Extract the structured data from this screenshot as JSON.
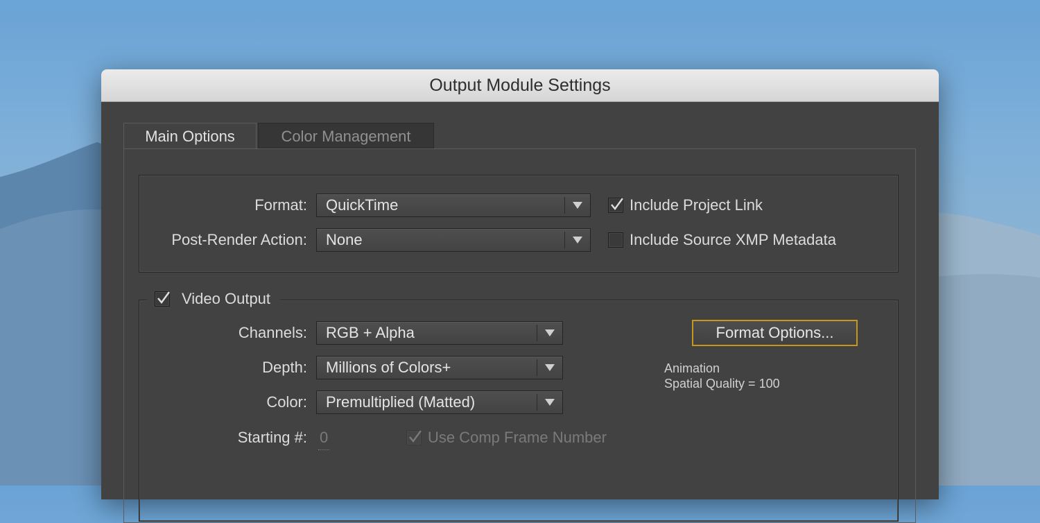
{
  "window": {
    "title": "Output Module Settings"
  },
  "tabs": [
    {
      "label": "Main Options",
      "active": true
    },
    {
      "label": "Color Management",
      "active": false
    }
  ],
  "main": {
    "format_label": "Format:",
    "format_value": "QuickTime",
    "post_render_label": "Post-Render Action:",
    "post_render_value": "None",
    "include_project_link": {
      "label": "Include Project Link",
      "checked": true
    },
    "include_xmp": {
      "label": "Include Source XMP Metadata",
      "checked": false
    }
  },
  "video_output": {
    "label": "Video Output",
    "checked": true,
    "channels_label": "Channels:",
    "channels_value": "RGB + Alpha",
    "depth_label": "Depth:",
    "depth_value": "Millions of Colors+",
    "color_label": "Color:",
    "color_value": "Premultiplied (Matted)",
    "starting_label": "Starting #:",
    "starting_value": "0",
    "use_comp_frame": {
      "label": "Use Comp Frame Number",
      "checked": true,
      "disabled": true
    },
    "format_options_button": "Format Options...",
    "info_line1": "Animation",
    "info_line2": "Spatial Quality = 100"
  },
  "colors": {
    "dialog_bg": "#424242",
    "focus_accent": "#c8961c"
  }
}
